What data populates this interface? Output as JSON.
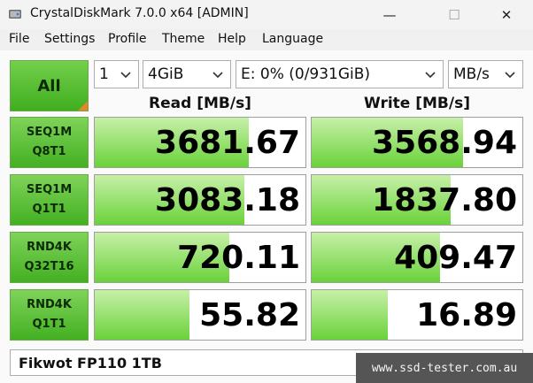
{
  "window": {
    "title": "CrystalDiskMark 7.0.0 x64 [ADMIN]",
    "minimize_glyph": "—",
    "maximize_glyph": "☐",
    "close_glyph": "✕"
  },
  "menu": [
    "File",
    "Settings",
    "Profile",
    "Theme",
    "Help",
    "Language"
  ],
  "controls": {
    "all_label": "All",
    "count": "1",
    "size": "4GiB",
    "drive": "E: 0% (0/931GiB)",
    "unit": "MB/s"
  },
  "headers": {
    "read": "Read [MB/s]",
    "write": "Write [MB/s]"
  },
  "tests": [
    {
      "line1": "SEQ1M",
      "line2": "Q8T1",
      "read": "3681.67",
      "write": "3568.94",
      "read_level": 0.73,
      "write_level": 0.72
    },
    {
      "line1": "SEQ1M",
      "line2": "Q1T1",
      "read": "3083.18",
      "write": "1837.80",
      "read_level": 0.71,
      "write_level": 0.66
    },
    {
      "line1": "RND4K",
      "line2": "Q32T16",
      "read": "720.11",
      "write": "409.47",
      "read_level": 0.64,
      "write_level": 0.61
    },
    {
      "line1": "RND4K",
      "line2": "Q1T1",
      "read": "55.82",
      "write": "16.89",
      "read_level": 0.45,
      "write_level": 0.36
    }
  ],
  "comment": "Fikwot FP110 1TB",
  "watermark": "www.ssd-tester.com.au",
  "colors": {
    "accent_green": "#43b022",
    "bar_light": "#c7f0a8",
    "bar_dark": "#6ad23a",
    "corner_orange": "#e6842a"
  }
}
